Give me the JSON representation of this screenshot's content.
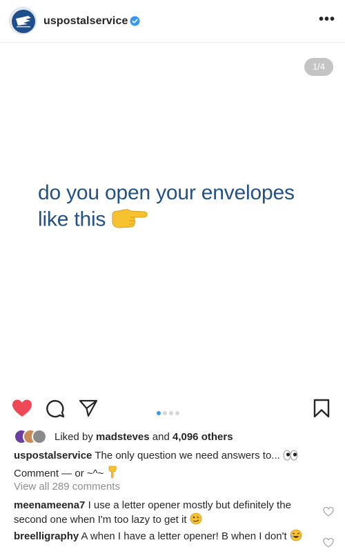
{
  "header": {
    "username": "uspostalservice",
    "more": "•••",
    "icons": {
      "verified": "verified-badge-icon",
      "more": "more-options-icon",
      "avatar": "usps-eagle-logo"
    }
  },
  "post": {
    "slide_counter": "1/4",
    "text_line1": "do you open your envelopes",
    "text_line2": "like this",
    "emoji": "pointing-right-hand-emoji",
    "text_color": "#245184",
    "carousel": {
      "current": 1,
      "total": 4
    }
  },
  "actions": {
    "icons": [
      "heart-filled-icon",
      "comment-icon",
      "share-icon",
      "bookmark-icon"
    ],
    "liked": true,
    "like_color": "#ed4956"
  },
  "likes": {
    "prefix": "Liked by",
    "liker": "madsteves",
    "conjunction": "and",
    "count_text": "4,096 others"
  },
  "caption": {
    "username": "uspostalservice",
    "text": "The only question we need answers to...",
    "text2": "Comment — or ~^~",
    "emojis": [
      "eyes-emoji",
      "pointing-down-emoji"
    ]
  },
  "view_all": "View all 289 comments",
  "comments": [
    {
      "username": "meenameena7",
      "text": "I use a letter opener mostly but definitely the second one when I'm too lazy to get it",
      "emoji": "woozy-face-emoji"
    },
    {
      "username": "breelligraphy",
      "text": "A when I have a letter opener! B when I don't",
      "emoji": "laughing-emoji"
    }
  ]
}
